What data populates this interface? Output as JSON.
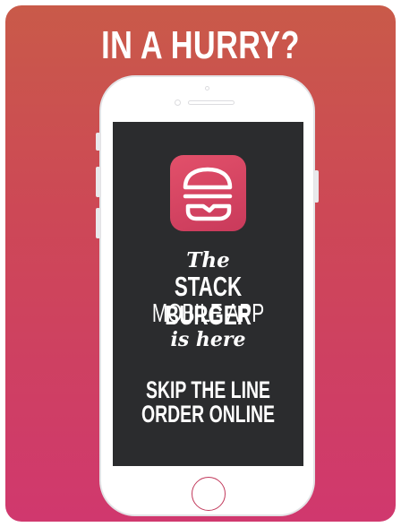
{
  "banner": {
    "headline": "IN A HURRY?"
  },
  "phone_screen": {
    "app_icon": "stacked-burger-icon",
    "line_the": "The",
    "line_brand": "STACK BURGER",
    "line_mobile": "MOBILE APP",
    "line_is_here": "is here",
    "line_skip": "SKIP THE LINE",
    "line_order": "ORDER ONLINE"
  },
  "colors": {
    "background_top": "#c95a49",
    "background_bottom": "#d0386e",
    "screen": "#2b2c2e",
    "icon_pink": "#e2506a"
  }
}
